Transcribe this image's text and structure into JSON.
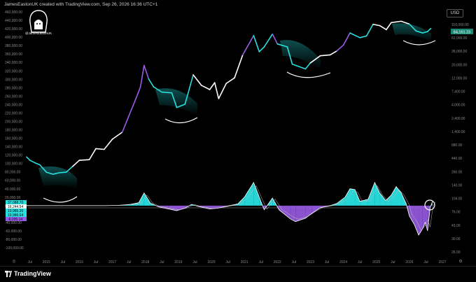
{
  "header": {
    "credit": "JamesEastonUK created with TradingView.com, Sep 26, 2026 16:36 UTC+1"
  },
  "logo": {
    "handle": "@JamesEastonUK"
  },
  "currency": "USD",
  "brand": "TradingView",
  "colors": {
    "cyan": "#28e0e0",
    "purple": "#9a5ce6",
    "white": "#ffffff",
    "background": "#000000",
    "price_tag": "#1a8a77"
  },
  "chart_data": {
    "type": "line",
    "x_tick_labels": [
      "Jul",
      "2015",
      "Jul",
      "2016",
      "Jul",
      "2017",
      "Jul",
      "2018",
      "Jul",
      "2019",
      "Jul",
      "2020",
      "Jul",
      "2021",
      "Jul",
      "2022",
      "Jul",
      "2023",
      "Jul",
      "2024",
      "Jul",
      "2025",
      "Jul",
      "2026",
      "Jul",
      "2027"
    ],
    "left_axis_labels": [
      "460,000.00",
      "440,000.00",
      "420,000.00",
      "400,000.00",
      "380,000.00",
      "360,000.00",
      "340,000.00",
      "320,000.00",
      "300,000.00",
      "280,000.00",
      "260,000.00",
      "240,000.00",
      "220,000.00",
      "200,000.00",
      "180,000.00",
      "160,000.00",
      "140,000.00",
      "120,000.00",
      "100,000.00",
      "80,000.00",
      "60,000.00",
      "40,000.00",
      "20,000.00",
      "0.00",
      "-20,000.00",
      "-40,000.00",
      "-60,000.00",
      "-80,000.00",
      "-100,000.00"
    ],
    "right_axis_labels": [
      "110,000.00",
      "62,000.00",
      "36,000.00",
      "20,000.00",
      "12,000.00",
      "7,400.00",
      "4,000.00",
      "2,400.00",
      "1,400.00",
      "880.00",
      "440.00",
      "260.00",
      "140.00",
      "104.00",
      "76.00",
      "43.00",
      "30.00",
      "26.00"
    ],
    "price_tag": "84,161.23",
    "left_tags": [
      {
        "label": "37,088.70",
        "color": "#28e0e0"
      },
      {
        "label": "16,244.54",
        "color": "#ffffff"
      },
      {
        "label": "10,985.20",
        "color": "#28e0e0"
      },
      {
        "label": "10,986.64",
        "color": "#28e0e0"
      },
      {
        "label": "-6,035.14",
        "color": "#9a5ce6"
      }
    ],
    "price_series": {
      "name": "Price",
      "points": [
        [
          2014.4,
          480
        ],
        [
          2014.5,
          420
        ],
        [
          2014.65,
          380
        ],
        [
          2014.8,
          350
        ],
        [
          2015.0,
          260
        ],
        [
          2015.2,
          240
        ],
        [
          2015.4,
          255
        ],
        [
          2015.6,
          260
        ],
        [
          2015.8,
          330
        ],
        [
          2016.0,
          420
        ],
        [
          2016.3,
          430
        ],
        [
          2016.5,
          670
        ],
        [
          2016.75,
          650
        ],
        [
          2017.0,
          980
        ],
        [
          2017.3,
          1300
        ],
        [
          2017.5,
          2500
        ],
        [
          2017.7,
          4800
        ],
        [
          2017.85,
          8000
        ],
        [
          2017.96,
          19000
        ],
        [
          2018.1,
          11000
        ],
        [
          2018.25,
          8000
        ],
        [
          2018.5,
          6500
        ],
        [
          2018.8,
          6300
        ],
        [
          2018.95,
          3500
        ],
        [
          2019.2,
          4000
        ],
        [
          2019.45,
          13000
        ],
        [
          2019.7,
          8500
        ],
        [
          2019.95,
          7200
        ],
        [
          2020.1,
          9500
        ],
        [
          2020.22,
          5000
        ],
        [
          2020.45,
          9200
        ],
        [
          2020.7,
          11500
        ],
        [
          2020.95,
          29000
        ],
        [
          2021.28,
          63000
        ],
        [
          2021.45,
          33000
        ],
        [
          2021.6,
          40000
        ],
        [
          2021.85,
          67000
        ],
        [
          2022.0,
          45000
        ],
        [
          2022.3,
          40000
        ],
        [
          2022.45,
          20000
        ],
        [
          2022.85,
          16500
        ],
        [
          2023.0,
          21000
        ],
        [
          2023.3,
          28000
        ],
        [
          2023.6,
          29000
        ],
        [
          2023.8,
          34000
        ],
        [
          2024.0,
          43000
        ],
        [
          2024.2,
          70000
        ],
        [
          2024.5,
          58000
        ],
        [
          2024.7,
          62000
        ],
        [
          2024.9,
          99000
        ],
        [
          2025.1,
          94000
        ],
        [
          2025.3,
          80000
        ],
        [
          2025.45,
          106000
        ],
        [
          2025.75,
          112000
        ],
        [
          2026.0,
          100000
        ],
        [
          2026.2,
          76000
        ],
        [
          2026.4,
          70000
        ],
        [
          2026.55,
          74000
        ],
        [
          2026.65,
          84161
        ]
      ]
    },
    "oscillator_series": {
      "name": "Oscillator",
      "points": [
        [
          2014.4,
          0
        ],
        [
          2016.8,
          0
        ],
        [
          2017.2,
          800
        ],
        [
          2017.55,
          3000
        ],
        [
          2017.8,
          7000
        ],
        [
          2017.96,
          30000
        ],
        [
          2018.15,
          6000
        ],
        [
          2018.4,
          -3000
        ],
        [
          2018.7,
          -8000
        ],
        [
          2018.95,
          -12000
        ],
        [
          2019.2,
          -6000
        ],
        [
          2019.4,
          3000
        ],
        [
          2019.6,
          -2000
        ],
        [
          2019.95,
          -8000
        ],
        [
          2020.2,
          -6000
        ],
        [
          2020.5,
          -1000
        ],
        [
          2020.8,
          4000
        ],
        [
          2021.0,
          20000
        ],
        [
          2021.28,
          55000
        ],
        [
          2021.45,
          20000
        ],
        [
          2021.6,
          -10000
        ],
        [
          2021.85,
          18000
        ],
        [
          2022.05,
          -10000
        ],
        [
          2022.4,
          -32000
        ],
        [
          2022.55,
          -38000
        ],
        [
          2022.85,
          -30000
        ],
        [
          2023.05,
          -18000
        ],
        [
          2023.3,
          -5000
        ],
        [
          2023.6,
          0
        ],
        [
          2023.8,
          5000
        ],
        [
          2024.05,
          20000
        ],
        [
          2024.2,
          40000
        ],
        [
          2024.35,
          38000
        ],
        [
          2024.5,
          10000
        ],
        [
          2024.75,
          15000
        ],
        [
          2024.95,
          55000
        ],
        [
          2025.1,
          30000
        ],
        [
          2025.28,
          12000
        ],
        [
          2025.45,
          25000
        ],
        [
          2025.6,
          45000
        ],
        [
          2025.75,
          30000
        ],
        [
          2025.9,
          5000
        ],
        [
          2026.0,
          -25000
        ],
        [
          2026.15,
          -45000
        ],
        [
          2026.28,
          -70000
        ],
        [
          2026.4,
          -55000
        ],
        [
          2026.48,
          -40000
        ],
        [
          2026.55,
          -60000
        ],
        [
          2026.63,
          -5000
        ],
        [
          2026.7,
          10000
        ]
      ]
    }
  }
}
